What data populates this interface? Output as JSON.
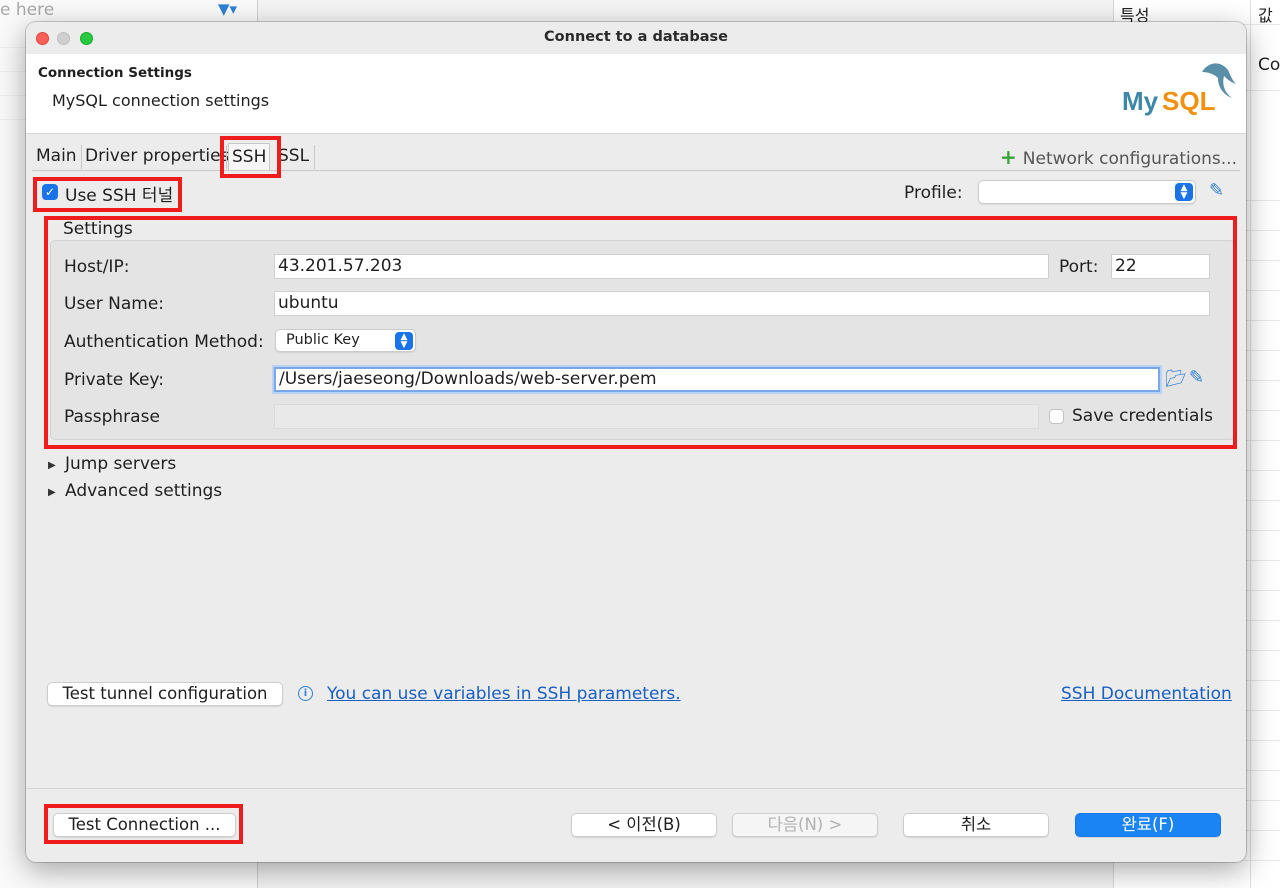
{
  "background": {
    "search_placeholder": "e here",
    "column_property": "특성",
    "column_value": "값",
    "cell_value": "Co"
  },
  "window": {
    "title": "Connect to a database"
  },
  "header": {
    "title": "Connection Settings",
    "subtitle": "MySQL connection settings",
    "logo_text": "MySQL"
  },
  "tabs": [
    {
      "label": "Main"
    },
    {
      "label": "Driver properties"
    },
    {
      "label": "SSH"
    },
    {
      "label": "SSL"
    }
  ],
  "network_configurations": "Network configurations...",
  "ssh": {
    "use_tunnel_label": "Use SSH 터널",
    "use_tunnel_checked": true,
    "profile_label": "Profile:",
    "profile_value": ""
  },
  "settings": {
    "group_label": "Settings",
    "host_label": "Host/IP:",
    "host_value": "43.201.57.203",
    "port_label": "Port:",
    "port_value": "22",
    "user_label": "User Name:",
    "user_value": "ubuntu",
    "auth_label": "Authentication Method:",
    "auth_value": "Public Key",
    "key_label": "Private Key:",
    "key_value": "/Users/jaeseong/Downloads/web-server.pem",
    "pass_label": "Passphrase",
    "pass_value": "",
    "save_credentials_label": "Save credentials",
    "save_credentials_checked": false
  },
  "sections": {
    "jump_servers": "Jump servers",
    "advanced_settings": "Advanced settings"
  },
  "actions": {
    "test_tunnel": "Test tunnel configuration",
    "variables_link": "You can use variables in SSH parameters.",
    "doc_link": "SSH Documentation"
  },
  "footer": {
    "test_connection": "Test Connection ...",
    "prev": "< 이전(B)",
    "next": "다음(N) >",
    "cancel": "취소",
    "finish": "완료(F)"
  },
  "colors": {
    "accent": "#1a84f5",
    "annotation_red": "#ee1c1c",
    "link": "#1a5fc4"
  }
}
